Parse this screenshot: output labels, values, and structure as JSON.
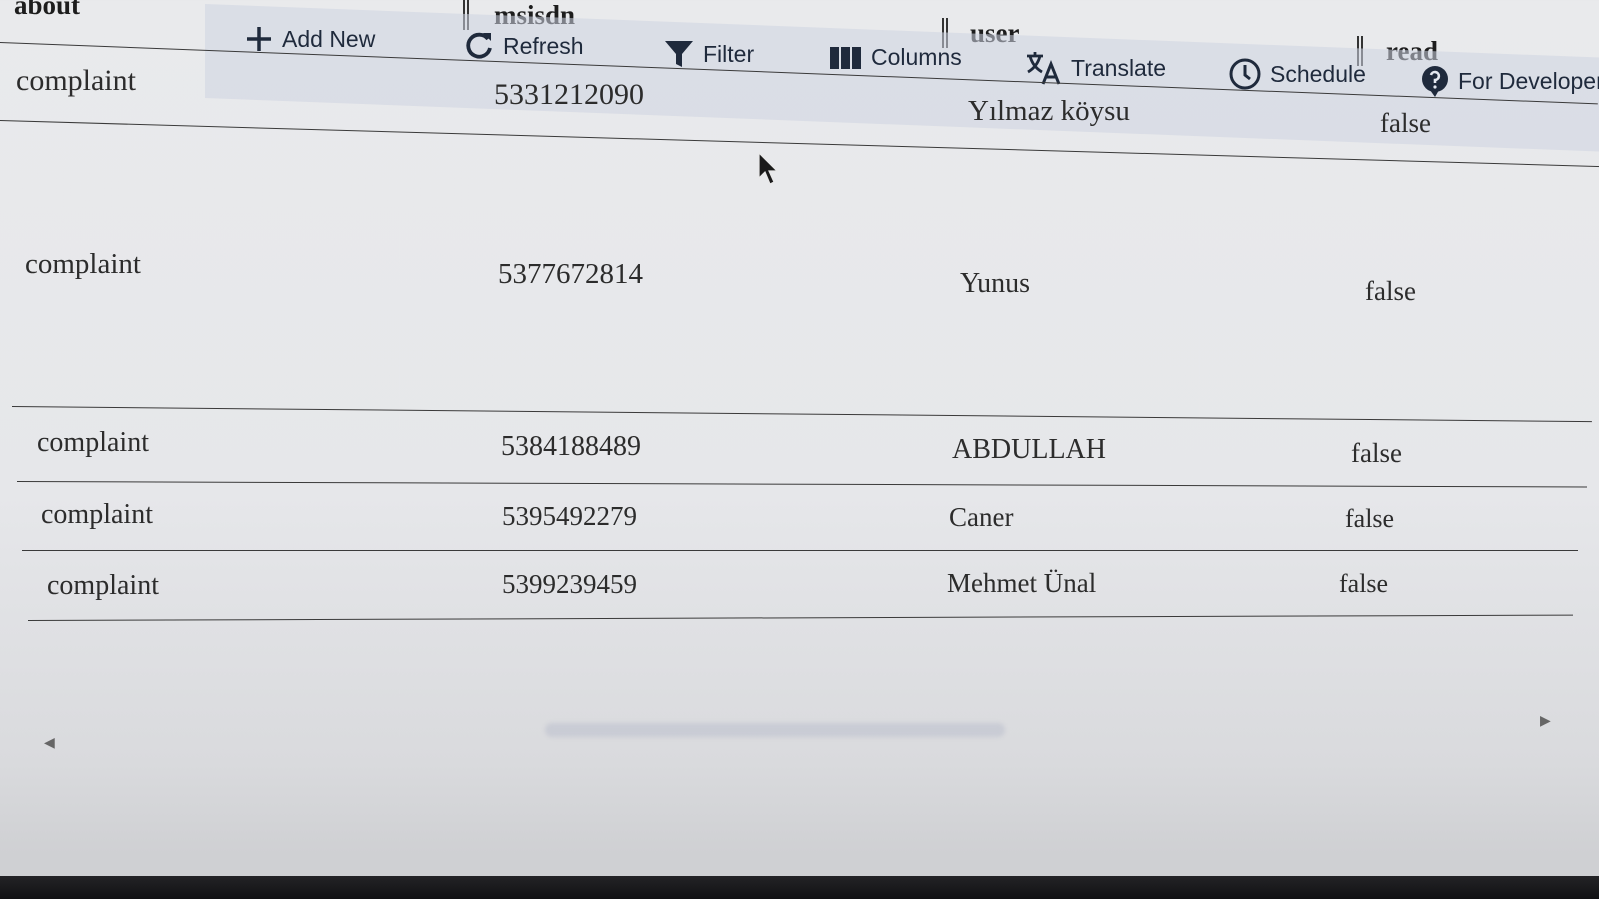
{
  "header": {
    "about_label": "about",
    "columns": [
      "msisdn",
      "user",
      "read"
    ]
  },
  "toolbar": {
    "add_new": "Add New",
    "refresh": "Refresh",
    "filter": "Filter",
    "columns": "Columns",
    "translate": "Translate",
    "schedule": "Schedule",
    "for_developers": "For Developers"
  },
  "rows": [
    {
      "about": "complaint",
      "msisdn": "5331212090",
      "user": "Yılmaz köysu",
      "read": "false"
    },
    {
      "about": "complaint",
      "msisdn": "5377672814",
      "user": "Yunus",
      "read": "false"
    },
    {
      "about": "complaint",
      "msisdn": "5384188489",
      "user": "ABDULLAH",
      "read": "false"
    },
    {
      "about": "complaint",
      "msisdn": "5395492279",
      "user": "Caner",
      "read": "false"
    },
    {
      "about": "complaint",
      "msisdn": "5399239459",
      "user": "Mehmet Ünal",
      "read": "false"
    }
  ],
  "colors": {
    "toolbar_bg": "#cdd4e2",
    "toolbar_text": "#1f2a3c",
    "rule": "#3a3a3a"
  }
}
